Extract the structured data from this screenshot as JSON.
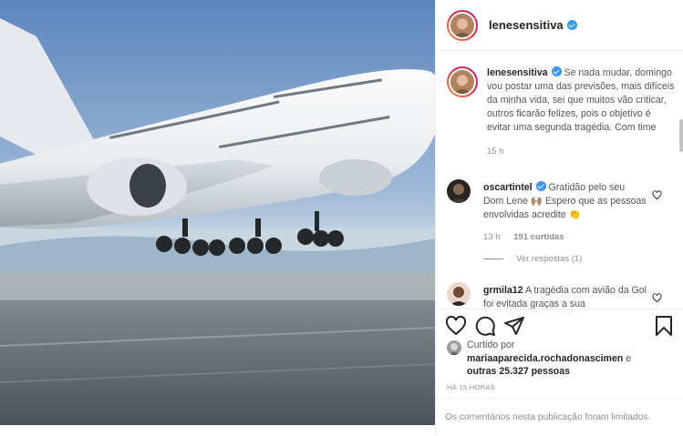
{
  "post": {
    "image": {
      "alt": ""
    },
    "author": {
      "username": "lenesensitiva",
      "verified": true
    },
    "caption": {
      "username": "lenesensitiva",
      "text": "Se nada mudar, domingo vou postar uma das previsões, mais difíceis da minha vida, sei que muitos vão criticar, outros ficarão felizes, pois o objetivo é evitar uma segunda tragédia. Com time",
      "time": "15 h"
    },
    "comments": [
      {
        "username": "oscartintel",
        "verified": true,
        "text": "Gratidão pelo seu Dom Lene 🙌🏽 Espero que as pessoas envolvidas acredite 👏",
        "time": "13 h",
        "likes": "191 curtidas",
        "replies": "Ver respostas (1)"
      },
      {
        "username": "grmila12",
        "verified": false,
        "text": "A tragédia com avião da Gol foi evitada graças a sua"
      }
    ],
    "actions": {
      "like": "heart-icon",
      "comment": "comment-icon",
      "share": "share-icon",
      "save": "bookmark-icon"
    },
    "likes": {
      "prefix": "Curtido por",
      "username": "mariaaparecida.rochadonascimen",
      "connector": "e",
      "others": "outras 25.327 pessoas"
    },
    "posted": "HÁ 15 HORAS",
    "comments_limited": "Os comentários nesta publicação foram limitados.",
    "colors": {
      "verified": "#3897f0",
      "text_primary": "#262626",
      "text_secondary": "#8e8e8e",
      "divider": "#efefef"
    }
  }
}
